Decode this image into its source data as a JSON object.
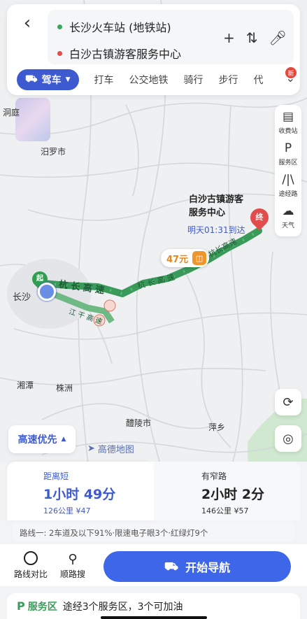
{
  "search": {
    "origin": "长沙火车站 (地铁站)",
    "destination": "白沙古镇游客服务中心",
    "origin_color": "#3ba55c",
    "destination_color": "#e34c4c"
  },
  "modes": {
    "active": "驾车",
    "items": [
      "打车",
      "公交地铁",
      "骑行",
      "步行",
      "代"
    ],
    "new_badge": "新"
  },
  "side_tools": [
    {
      "icon": "toll-station-icon",
      "label": "收费站"
    },
    {
      "icon": "service-area-icon",
      "label": "服务区"
    },
    {
      "icon": "waypoint-icon",
      "label": "途经路"
    },
    {
      "icon": "weather-icon",
      "label": "天气"
    }
  ],
  "map": {
    "labels": {
      "hechuan": "汨罗市",
      "changsha": "长沙",
      "xiangtan": "湘潭",
      "zhuzhou": "株洲",
      "liling": "醴陵市",
      "pingxiang": "萍乡",
      "top_left": "洞庭"
    },
    "road_labels": {
      "hang_chang_1": "杭 长 高 速",
      "hang_chang_2": "杭 长 高 速",
      "hang_chang_3": "杭长高速",
      "jiang_gan": "江 干 高 速"
    },
    "destination_name_1": "白沙古镇游客",
    "destination_name_2": "服务中心",
    "arrival": "明天01:31到达",
    "toll": "47元",
    "start_marker": "起",
    "end_marker": "终",
    "route_color": "#3a9a5a"
  },
  "priority": "高速优先",
  "amap_logo": "高德地图",
  "routes": [
    {
      "tag": "距离短",
      "time": "1小时 49分",
      "distance": "126公里",
      "cost": "¥47"
    },
    {
      "tag": "有窄路",
      "time": "2小时 2分",
      "distance": "146公里",
      "cost": "¥57"
    }
  ],
  "route_info": "路线一: 2车道及以下91%·限速电子眼3个·红绿灯9个",
  "actions": {
    "compare": "路线对比",
    "search_along": "顺路搜",
    "start_nav": "开始导航"
  },
  "service": {
    "title": "服务区",
    "text": "途经3个服务区，3个可加油"
  }
}
